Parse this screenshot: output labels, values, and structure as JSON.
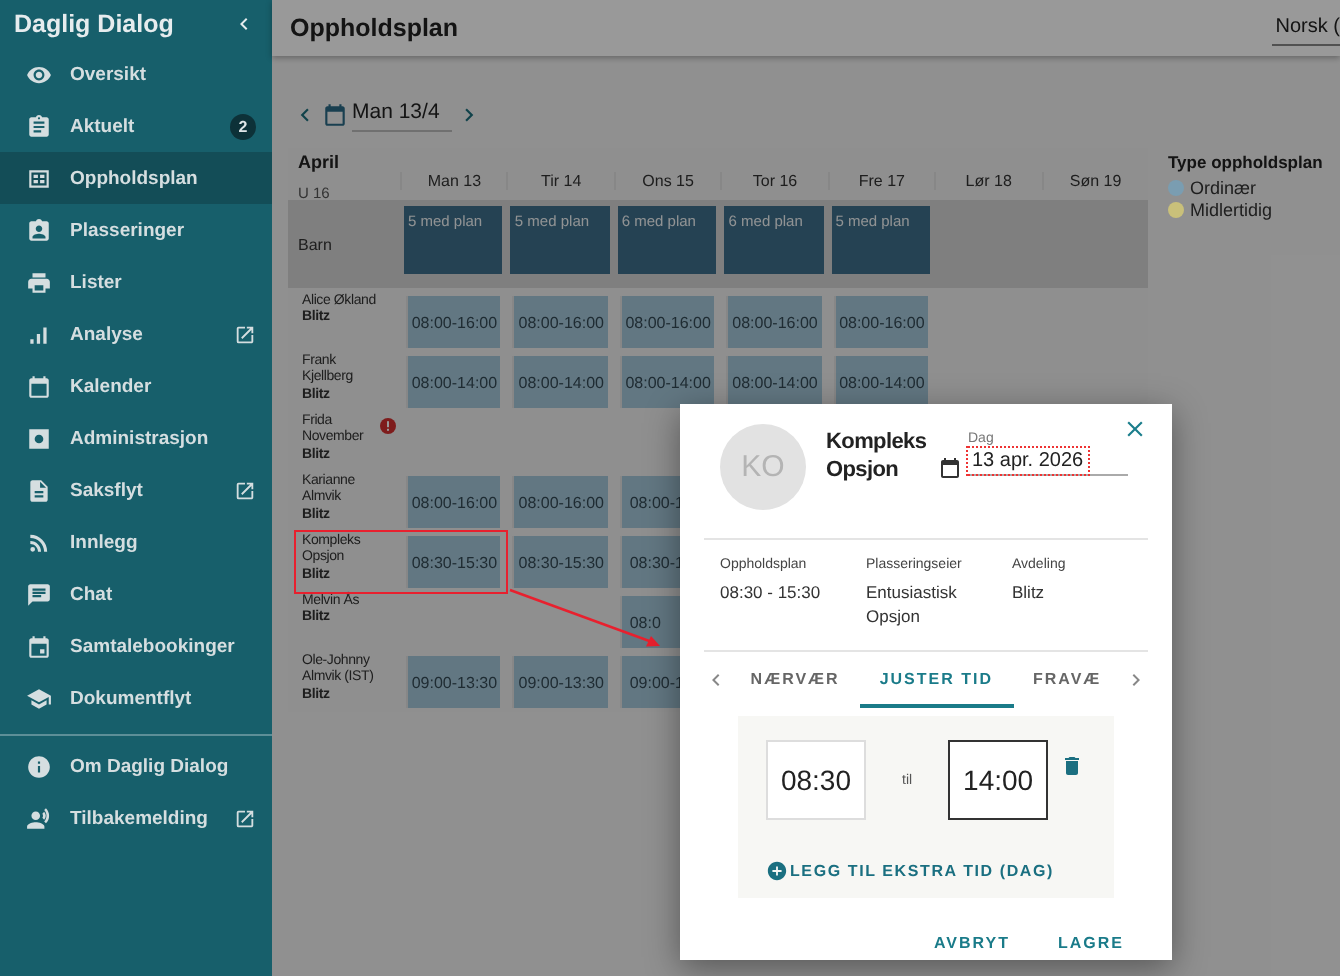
{
  "sidebar": {
    "title": "Daglig Dialog",
    "items": [
      {
        "label": "Oversikt",
        "selected": false,
        "external": false
      },
      {
        "label": "Aktuelt",
        "selected": false,
        "external": false,
        "badge": "2"
      },
      {
        "label": "Oppholdsplan",
        "selected": true,
        "external": false
      },
      {
        "label": "Plasseringer",
        "selected": false,
        "external": false
      },
      {
        "label": "Lister",
        "selected": false,
        "external": false
      },
      {
        "label": "Analyse",
        "selected": false,
        "external": true
      },
      {
        "label": "Kalender",
        "selected": false,
        "external": false
      },
      {
        "label": "Administrasjon",
        "selected": false,
        "external": false
      },
      {
        "label": "Saksflyt",
        "selected": false,
        "external": true
      },
      {
        "label": "Innlegg",
        "selected": false,
        "external": false
      },
      {
        "label": "Chat",
        "selected": false,
        "external": false
      },
      {
        "label": "Samtalebookinger",
        "selected": false,
        "external": false
      },
      {
        "label": "Dokumentflyt",
        "selected": false,
        "external": false
      }
    ],
    "footer_items": [
      {
        "label": "Om Daglig Dialog",
        "selected": false,
        "external": false
      },
      {
        "label": "Tilbakemelding",
        "selected": false,
        "external": true
      }
    ]
  },
  "header": {
    "title": "Oppholdsplan",
    "language": "Norsk ("
  },
  "date_nav": {
    "value": "Man 13/4"
  },
  "plan": {
    "month": "April",
    "week": "U 16",
    "days": [
      "Man 13",
      "Tir 14",
      "Ons 15",
      "Tor 16",
      "Fre 17",
      "Lør 18",
      "Søn 19"
    ],
    "summary_row": {
      "label": "Barn",
      "cells": [
        "5 med plan",
        "5 med plan",
        "6 med plan",
        "6 med plan",
        "5 med plan",
        null,
        null
      ]
    },
    "rows": [
      {
        "name": "Alice Økland",
        "group": "Blitz",
        "alert": false,
        "highlighted": false,
        "cells": [
          "08:00-16:00",
          "08:00-16:00",
          "08:00-16:00",
          "08:00-16:00",
          "08:00-16:00",
          null,
          null
        ]
      },
      {
        "name": "Frank Kjellberg",
        "group": "Blitz",
        "alert": false,
        "highlighted": false,
        "cells": [
          "08:00-14:00",
          "08:00-14:00",
          "08:00-14:00",
          "08:00-14:00",
          "08:00-14:00",
          null,
          null
        ]
      },
      {
        "name": "Frida November",
        "group": "Blitz",
        "alert": true,
        "highlighted": false,
        "cells": [
          null,
          null,
          null,
          null,
          null,
          null,
          null
        ]
      },
      {
        "name": "Karianne Almvik",
        "group": "Blitz",
        "alert": false,
        "highlighted": false,
        "cells": [
          "08:00-16:00",
          "08:00-16:00",
          "08:00-1",
          null,
          null,
          null,
          null
        ]
      },
      {
        "name": "Kompleks Opsjon",
        "group": "Blitz",
        "alert": false,
        "highlighted": true,
        "cells": [
          "08:30-15:30",
          "08:30-15:30",
          "08:30-1",
          null,
          null,
          null,
          null
        ]
      },
      {
        "name": "Melvin Ås",
        "group": "Blitz",
        "alert": false,
        "highlighted": false,
        "cells": [
          null,
          null,
          "08:0",
          null,
          null,
          null,
          null
        ]
      },
      {
        "name": "Ole-Johnny Almvik (IST)",
        "group": "Blitz",
        "alert": false,
        "highlighted": false,
        "cells": [
          "09:00-13:30",
          "09:00-13:30",
          "09:00-1",
          null,
          null,
          null,
          null
        ]
      }
    ]
  },
  "legend": {
    "title": "Type oppholdsplan",
    "items": [
      {
        "label": "Ordinær",
        "color": "#7a9db1"
      },
      {
        "label": "Midlertidig",
        "color": "#c9c07a"
      }
    ]
  },
  "dialog": {
    "avatar_initials": "KO",
    "name": "Kompleks Opsjon",
    "date": {
      "label": "Dag",
      "value": "13 apr. 2026"
    },
    "info": [
      {
        "label": "Oppholdsplan",
        "value": "08:30 - 15:30"
      },
      {
        "label": "Plasseringseier",
        "value": "Entusiastisk Opsjon"
      },
      {
        "label": "Avdeling",
        "value": "Blitz"
      }
    ],
    "tabs": [
      {
        "label": "NÆRVÆR",
        "selected": false
      },
      {
        "label": "JUSTER TID",
        "selected": true
      },
      {
        "label": "FRAVÆ",
        "selected": false
      }
    ],
    "time_range": {
      "from": "08:30",
      "separator": "til",
      "to": "14:00"
    },
    "add_link": "LEGG TIL EKSTRA TID (DAG)",
    "buttons": [
      "AVBRYT",
      "LAGRE"
    ]
  }
}
